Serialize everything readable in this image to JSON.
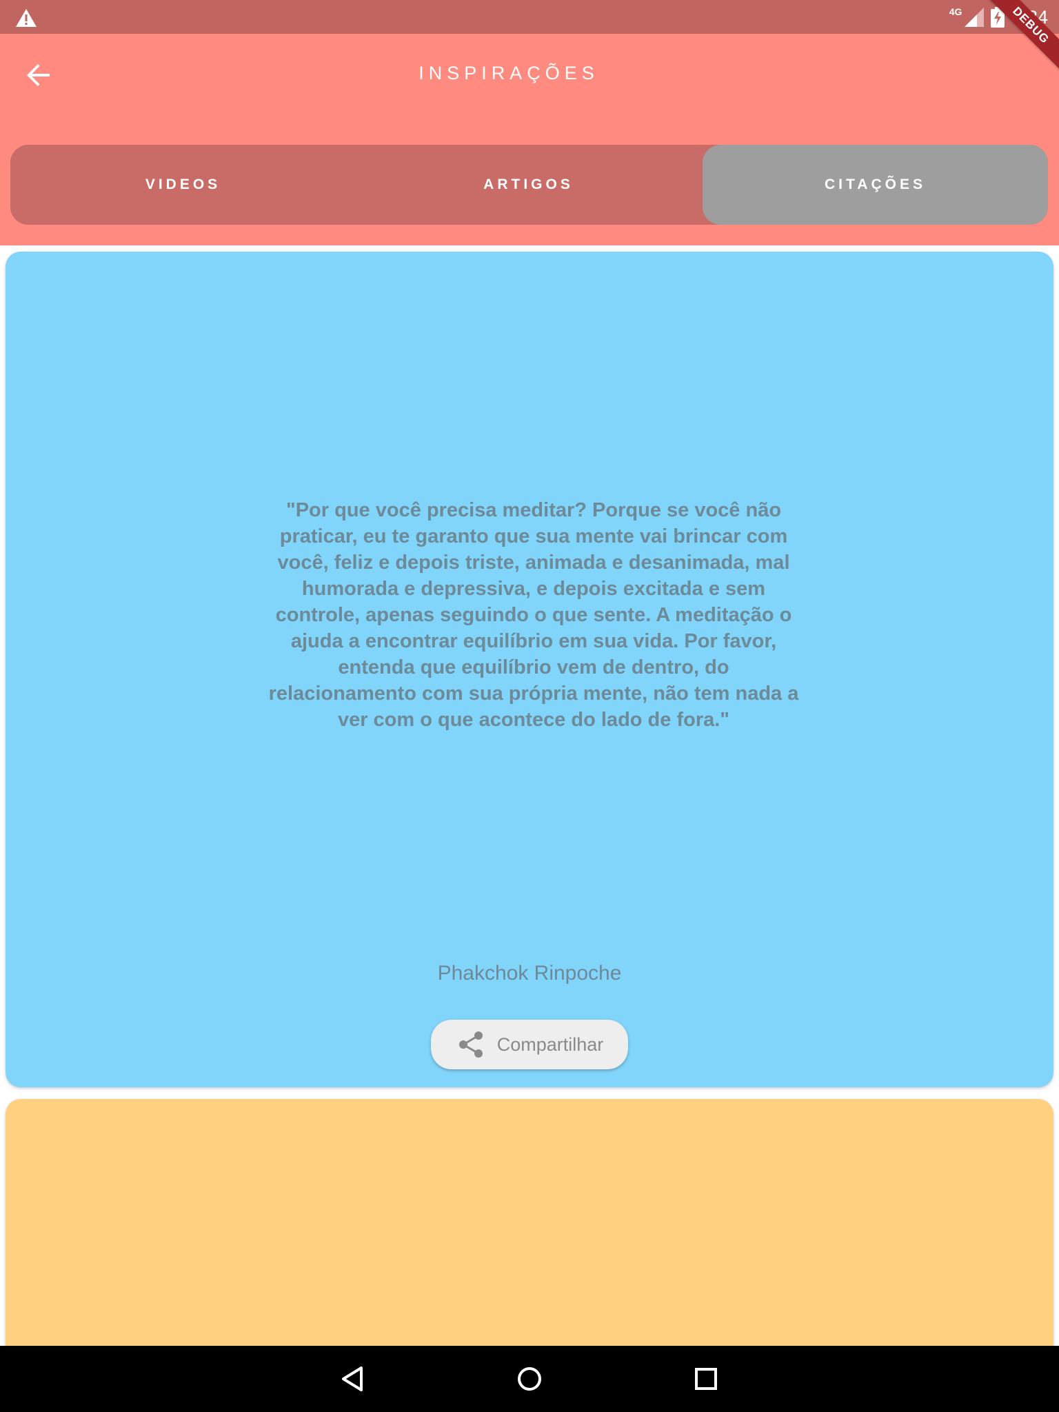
{
  "status_bar": {
    "network": "4G",
    "time": "5:34",
    "warning_icon": "warning-icon",
    "signal_icon": "signal-icon",
    "battery_icon": "battery-charging-icon"
  },
  "debug_banner": "DEBUG",
  "app_bar": {
    "title": "INSPIRAÇÕES",
    "back_icon": "arrow-back-icon",
    "background": "#ff8a80"
  },
  "tabs": [
    {
      "label": "VIDEOS",
      "active": false
    },
    {
      "label": "ARTIGOS",
      "active": false
    },
    {
      "label": "CITAÇÕES",
      "active": true
    }
  ],
  "quotes": [
    {
      "text": "\"Por que você precisa meditar? Porque se você não praticar, eu te garanto que sua mente vai brincar com você, feliz e depois triste, animada e desanimada, mal humorada e depressiva, e depois excitada e sem controle, apenas seguindo o que sente. A meditação o ajuda a encontrar equilíbrio em sua vida. Por favor, entenda que equilíbrio vem de dentro, do relacionamento com sua própria mente, não tem nada a ver com o que acontece do lado de fora.\"",
      "author": "Phakchok Rinpoche",
      "share_label": "Compartilhar",
      "share_icon": "share-icon",
      "color": "#81d4fa"
    },
    {
      "color": "#ffd180"
    }
  ],
  "nav_bar": {
    "back_icon": "nav-back-icon",
    "home_icon": "nav-home-icon",
    "recents_icon": "nav-recents-icon"
  }
}
